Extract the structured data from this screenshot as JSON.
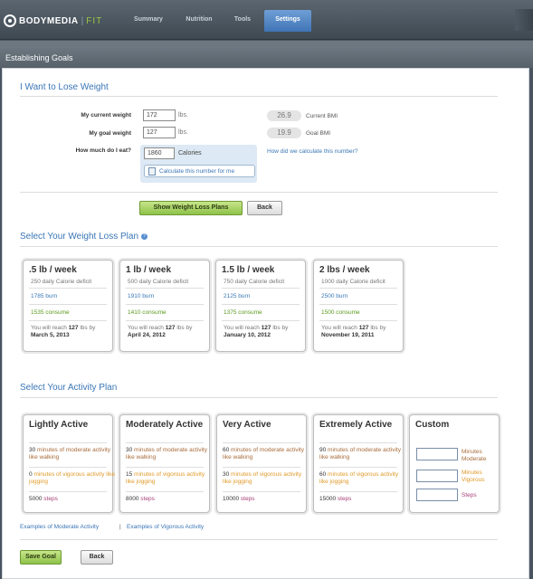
{
  "brand": {
    "name": "BODYMEDIA",
    "product": "FIT"
  },
  "nav": {
    "tabs": [
      "Summary",
      "Nutrition",
      "Tools",
      "Settings"
    ],
    "active": "Settings"
  },
  "section_title": "Establishing Goals",
  "lose_weight": {
    "heading": "I Want to Lose Weight",
    "current_weight_label": "My current weight",
    "current_weight_value": "172",
    "goal_weight_label": "My goal weight",
    "goal_weight_value": "127",
    "unit_lbs": "lbs.",
    "current_bmi_value": "26.9",
    "current_bmi_label": "Current BMI",
    "goal_bmi_value": "19.9",
    "goal_bmi_label": "Goal BMI",
    "eat_label": "How much do I eat?",
    "eat_value": "1860",
    "eat_unit": "Calories",
    "calc_button": "Calculate this number for me",
    "how_link": "How did we calculate this number?",
    "show_plans_button": "Show Weight Loss Plans",
    "back_button": "Back"
  },
  "plans": {
    "heading": "Select Your Weight Loss Plan",
    "items": [
      {
        "title": ".5 lb / week",
        "deficit": "250 daily Calorie deficit",
        "burn": "1785",
        "burn_label": "burn",
        "consume": "1535",
        "consume_label": "consume",
        "reach_pre": "You will reach",
        "reach_lbs": "127",
        "reach_post": "lbs by",
        "date": "March 5, 2013"
      },
      {
        "title": "1 lb / week",
        "deficit": "500 daily Calorie deficit",
        "burn": "1910",
        "burn_label": "burn",
        "consume": "1410",
        "consume_label": "consume",
        "reach_pre": "You will reach",
        "reach_lbs": "127",
        "reach_post": "lbs by",
        "date": "April 24, 2012"
      },
      {
        "title": "1.5 lb / week",
        "deficit": "750 daily Calorie deficit",
        "burn": "2125",
        "burn_label": "burn",
        "consume": "1375",
        "consume_label": "consume",
        "reach_pre": "You will reach",
        "reach_lbs": "127",
        "reach_post": "lbs by",
        "date": "January 10, 2012"
      },
      {
        "title": "2 lbs / week",
        "deficit": "1000 daily Calorie deficit",
        "burn": "2500",
        "burn_label": "burn",
        "consume": "1500",
        "consume_label": "consume",
        "reach_pre": "You will reach",
        "reach_lbs": "127",
        "reach_post": "lbs by",
        "date": "November 19, 2011"
      }
    ]
  },
  "activity": {
    "heading": "Select Your Activity Plan",
    "items": [
      {
        "title": "Lightly Active",
        "mod_num": "30",
        "mod_text": "minutes of moderate activity like walking",
        "vig_num": "0",
        "vig_text": "minutes of vigorous activity like jogging",
        "steps_num": "5000",
        "steps_text": "steps"
      },
      {
        "title": "Moderately Active",
        "mod_num": "30",
        "mod_text": "minutes of moderate activity like walking",
        "vig_num": "15",
        "vig_text": "minutes of vigorous activity like jogging",
        "steps_num": "8000",
        "steps_text": "steps"
      },
      {
        "title": "Very Active",
        "mod_num": "60",
        "mod_text": "minutes of moderate activity like walking",
        "vig_num": "30",
        "vig_text": "minutes of vigorous activity like jogging",
        "steps_num": "10000",
        "steps_text": "steps"
      },
      {
        "title": "Extremely Active",
        "mod_num": "90",
        "mod_text": "minutes of moderate activity like walking",
        "vig_num": "60",
        "vig_text": "minutes of vigorous activity like jogging",
        "steps_num": "15000",
        "steps_text": "steps"
      }
    ],
    "custom": {
      "title": "Custom",
      "moderate": "Minutes Moderate",
      "vigorous": "Minutes Vigorous",
      "steps": "Steps"
    },
    "link_moderate": "Examples of Moderate Activity",
    "link_sep": "|",
    "link_vigorous": "Examples of Vigorous Activity"
  },
  "footer": {
    "save_button": "Save Goal",
    "back_button": "Back"
  },
  "colors": {
    "accent_blue": "#3a76b6",
    "green": "#8fc24a",
    "burn": "#3a76b6",
    "consume": "#5a9a1e",
    "moderate": "#a86b3a",
    "vigorous": "#e09a2a",
    "steps": "#a8427a"
  }
}
